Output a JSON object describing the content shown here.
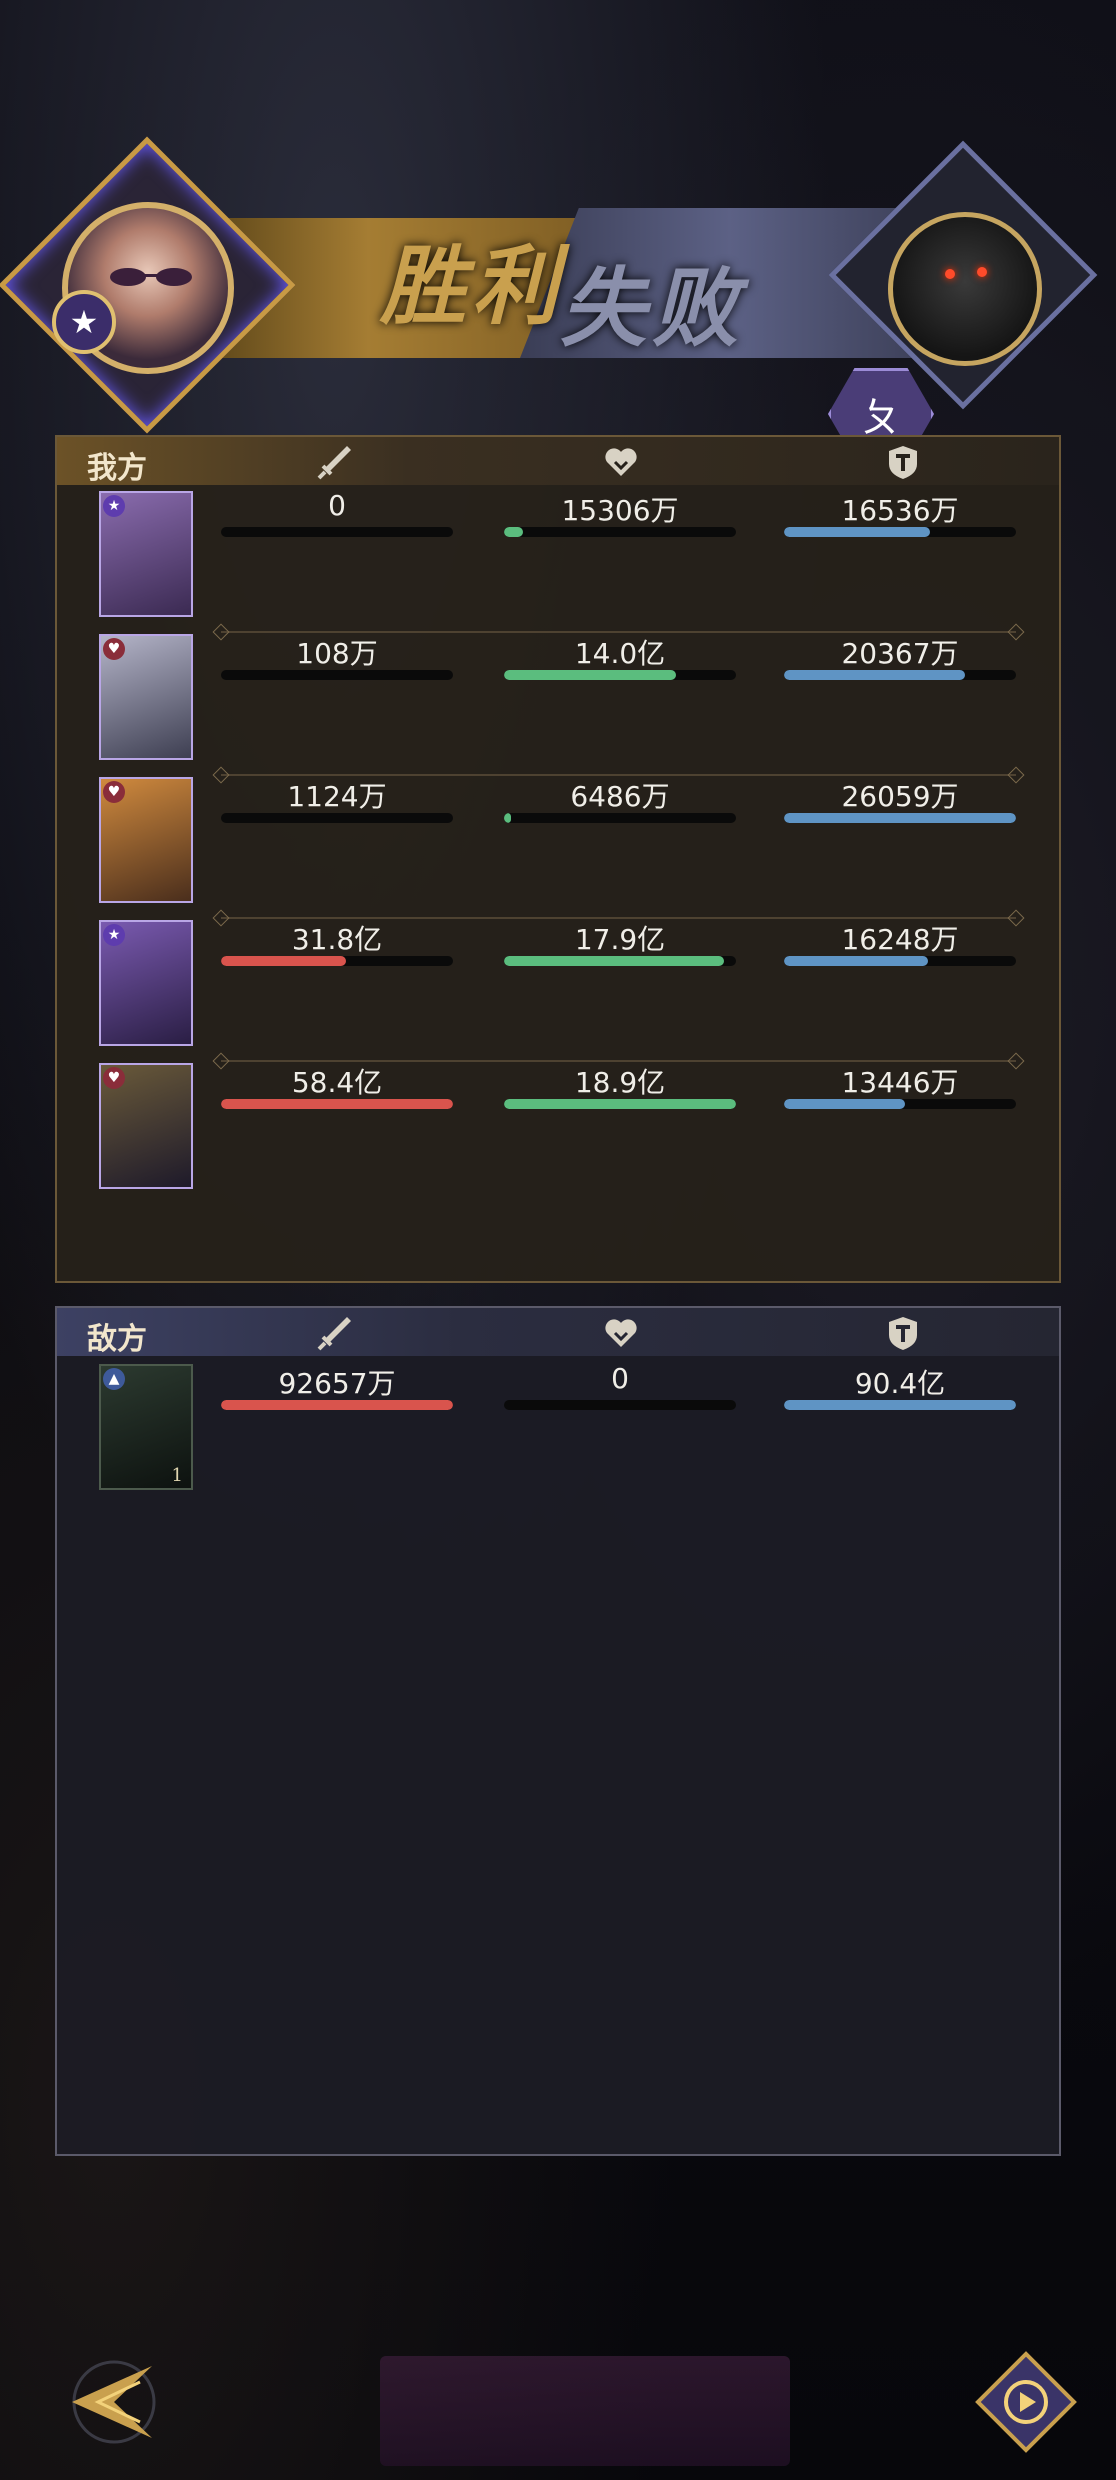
{
  "banner": {
    "victory_text": "胜利",
    "defeat_text": "失败",
    "stat_hex_glyph": "ㄆ",
    "player_badge_icon": "star-icon",
    "enemy_avatar": "demon-beast"
  },
  "columns": {
    "attack_icon": "sword-icon",
    "heal_icon": "heart-icon",
    "defense_icon": "shield-icon"
  },
  "ally": {
    "title": "我方",
    "heroes": [
      {
        "attack": "0",
        "attack_ratio": 0.0,
        "heal": "15306万",
        "heal_ratio": 0.08,
        "defense": "16536万",
        "defense_ratio": 0.63,
        "portrait_color": "#6a4a8a"
      },
      {
        "attack": "108万",
        "attack_ratio": 0.0,
        "heal": "14.0亿",
        "heal_ratio": 0.74,
        "defense": "20367万",
        "defense_ratio": 0.78,
        "portrait_color": "#7a7a90"
      },
      {
        "attack": "1124万",
        "attack_ratio": 0.0,
        "heal": "6486万",
        "heal_ratio": 0.03,
        "defense": "26059万",
        "defense_ratio": 1.0,
        "portrait_color": "#a6652e"
      },
      {
        "attack": "31.8亿",
        "attack_ratio": 0.54,
        "heal": "17.9亿",
        "heal_ratio": 0.95,
        "defense": "16248万",
        "defense_ratio": 0.62,
        "portrait_color": "#5b3a86"
      },
      {
        "attack": "58.4亿",
        "attack_ratio": 1.0,
        "heal": "18.9亿",
        "heal_ratio": 1.0,
        "defense": "13446万",
        "defense_ratio": 0.52,
        "portrait_color": "#3d3050"
      }
    ]
  },
  "enemy": {
    "title": "敌方",
    "units": [
      {
        "attack": "92657万",
        "attack_ratio": 1.0,
        "heal": "0",
        "heal_ratio": 0.0,
        "defense": "90.4亿",
        "defense_ratio": 1.0,
        "level": "1",
        "portrait_color": "#1d2a22"
      }
    ]
  }
}
